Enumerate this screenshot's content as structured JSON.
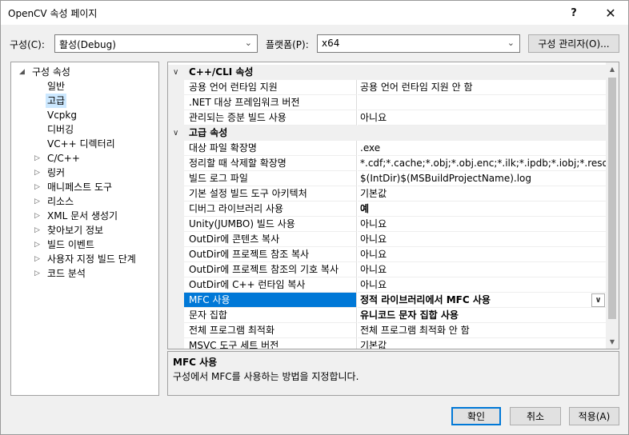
{
  "window": {
    "title": "OpenCV 속성 페이지",
    "help_glyph": "?",
    "close_glyph": "✕"
  },
  "toolbar": {
    "config_label": "구성(C):",
    "config_value": "활성(Debug)",
    "platform_label": "플랫폼(P):",
    "platform_value": "x64",
    "config_manager_label": "구성 관리자(O)...",
    "dropdown_icon": "chevron-down-icon"
  },
  "tree": {
    "items": [
      {
        "label": "구성 속성",
        "level": 0,
        "arrow": "◢"
      },
      {
        "label": "일반",
        "level": 1,
        "arrow": ""
      },
      {
        "label": "고급",
        "level": 1,
        "arrow": "",
        "selected": true
      },
      {
        "label": "Vcpkg",
        "level": 1,
        "arrow": ""
      },
      {
        "label": "디버깅",
        "level": 1,
        "arrow": ""
      },
      {
        "label": "VC++ 디렉터리",
        "level": 1,
        "arrow": ""
      },
      {
        "label": "C/C++",
        "level": 1,
        "arrow": "▷"
      },
      {
        "label": "링커",
        "level": 1,
        "arrow": "▷"
      },
      {
        "label": "매니페스트 도구",
        "level": 1,
        "arrow": "▷"
      },
      {
        "label": "리소스",
        "level": 1,
        "arrow": "▷"
      },
      {
        "label": "XML 문서 생성기",
        "level": 1,
        "arrow": "▷"
      },
      {
        "label": "찾아보기 정보",
        "level": 1,
        "arrow": "▷"
      },
      {
        "label": "빌드 이벤트",
        "level": 1,
        "arrow": "▷"
      },
      {
        "label": "사용자 지정 빌드 단계",
        "level": 1,
        "arrow": "▷"
      },
      {
        "label": "코드 분석",
        "level": 1,
        "arrow": "▷"
      }
    ]
  },
  "grid": {
    "rows": [
      {
        "type": "category",
        "label": "C++/CLI 속성"
      },
      {
        "type": "prop",
        "name": "공용 언어 런타임 지원",
        "value": "공용 언어 런타임 지원 안 함"
      },
      {
        "type": "prop",
        "name": ".NET 대상 프레임워크 버전",
        "value": ""
      },
      {
        "type": "prop",
        "name": "관리되는 증분 빌드 사용",
        "value": "아니요"
      },
      {
        "type": "category",
        "label": "고급 속성"
      },
      {
        "type": "prop",
        "name": "대상 파일 확장명",
        "value": ".exe"
      },
      {
        "type": "prop",
        "name": "정리할 때 삭제할 확장명",
        "value": "*.cdf;*.cache;*.obj;*.obj.enc;*.ilk;*.ipdb;*.iobj;*.resources;*.t"
      },
      {
        "type": "prop",
        "name": "빌드 로그 파일",
        "value": "$(IntDir)$(MSBuildProjectName).log"
      },
      {
        "type": "prop",
        "name": "기본 설정 빌드 도구 아키텍처",
        "value": "기본값"
      },
      {
        "type": "prop",
        "name": "디버그 라이브러리 사용",
        "value": "예",
        "bold": true
      },
      {
        "type": "prop",
        "name": "Unity(JUMBO) 빌드 사용",
        "value": "아니요"
      },
      {
        "type": "prop",
        "name": "OutDir에 콘텐츠 복사",
        "value": "아니요"
      },
      {
        "type": "prop",
        "name": "OutDir에 프로젝트 참조 복사",
        "value": "아니요"
      },
      {
        "type": "prop",
        "name": "OutDir에 프로젝트 참조의 기호 복사",
        "value": "아니요"
      },
      {
        "type": "prop",
        "name": "OutDir에 C++ 런타임 복사",
        "value": "아니요"
      },
      {
        "type": "prop",
        "name": "MFC 사용",
        "value": "정적 라이브러리에서 MFC 사용",
        "bold": true,
        "selected": true
      },
      {
        "type": "prop",
        "name": "문자 집합",
        "value": "유니코드 문자 집합 사용",
        "bold": true
      },
      {
        "type": "prop",
        "name": "전체 프로그램 최적화",
        "value": "전체 프로그램 최적화 안 함"
      },
      {
        "type": "prop",
        "name": "MSVC 도구 세트 버전",
        "value": "기본값"
      }
    ]
  },
  "description": {
    "title": "MFC 사용",
    "text": "구성에서 MFC를 사용하는 방법을 지정합니다."
  },
  "buttons": {
    "ok": "확인",
    "cancel": "취소",
    "apply": "적용(A)"
  }
}
